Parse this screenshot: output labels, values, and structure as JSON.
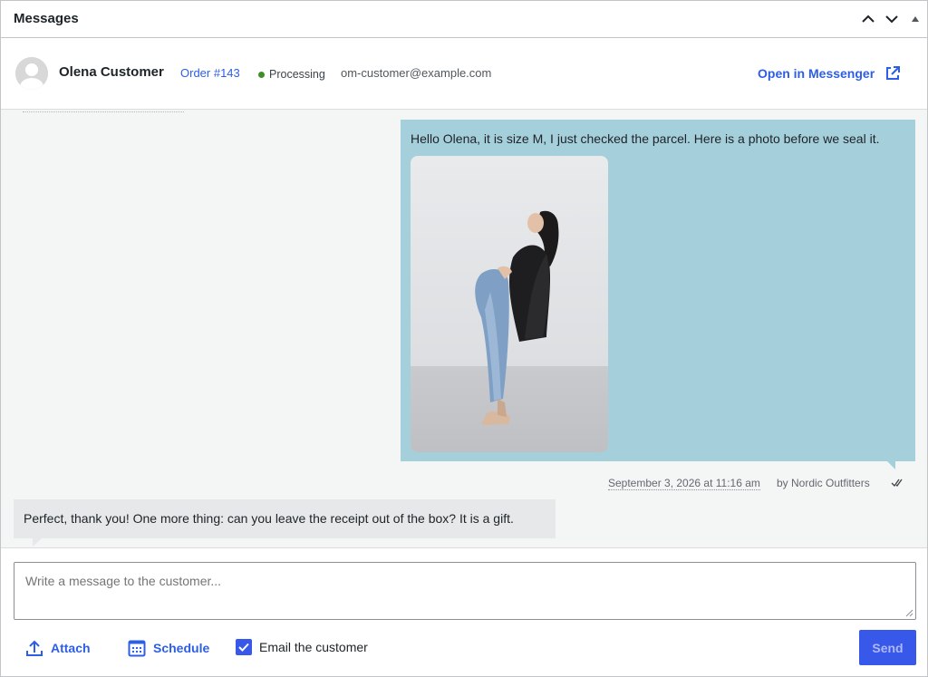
{
  "panel": {
    "title": "Messages",
    "controls": [
      "chevron-up-icon",
      "chevron-down-icon",
      "triangle-up-icon"
    ]
  },
  "customer": {
    "name": "Olena Customer",
    "order": "Order #143",
    "status": "Processing",
    "status_color": "#3f8f29",
    "email": "om-customer@example.com",
    "open_link": "Open in Messenger"
  },
  "messages": [
    {
      "direction": "outgoing",
      "text": "Hello Olena, it is size M, I just checked the parcel. Here is a photo before we seal it.",
      "has_photo": true,
      "timestamp": "September 3, 2026 at 11:16 am",
      "author": "by Nordic Outfitters",
      "read_icon": "double-check-icon",
      "bubble_color": "#a6cfdc"
    },
    {
      "direction": "incoming",
      "text": "Perfect, thank you! One more thing: can you leave the receipt out of the box? It is a gift.",
      "bubble_color": "#e7e8e9"
    }
  ],
  "composer": {
    "placeholder": "Write a message to the customer...",
    "value": ""
  },
  "toolbar": {
    "attach_label": "Attach",
    "schedule_label": "Schedule",
    "email_label": "Email the customer",
    "email_checked": true,
    "send_label": "Send"
  },
  "colors": {
    "accent": "#2c5ee6",
    "send_button": "#3858e9"
  }
}
